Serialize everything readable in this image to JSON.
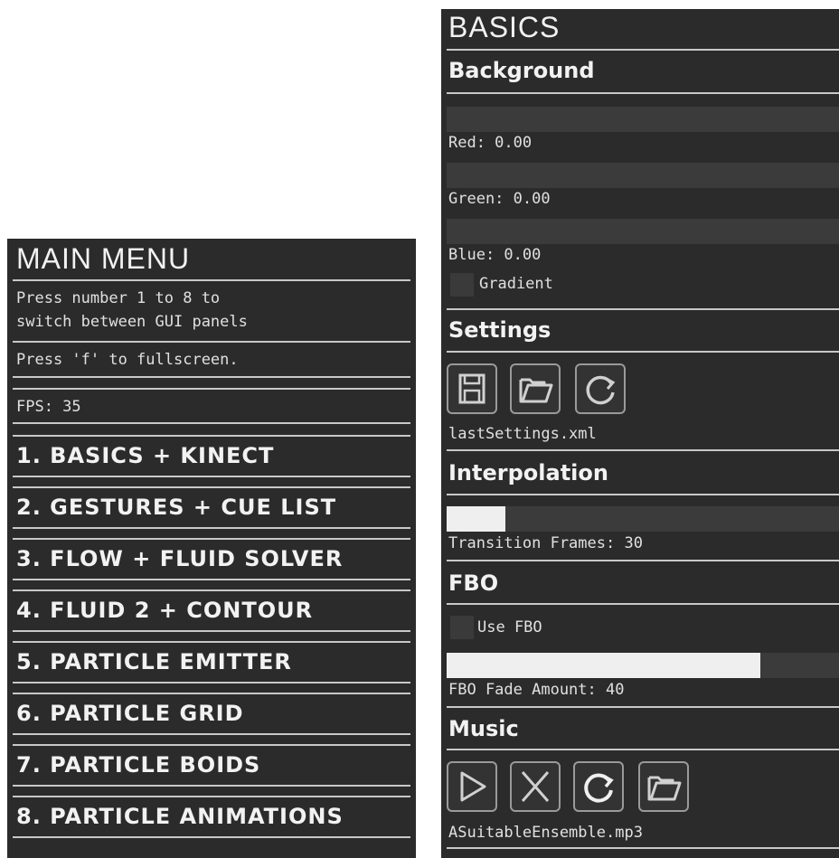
{
  "main_menu": {
    "title": "MAIN MENU",
    "help_line1": "Press number 1 to 8 to",
    "help_line2": "switch between GUI panels",
    "fullscreen_hint": "Press 'f' to fullscreen.",
    "fps": "FPS: 35",
    "items": [
      "1. BASICS + KINECT",
      "2. GESTURES + CUE LIST",
      "3. FLOW + FLUID SOLVER",
      "4. FLUID 2 + CONTOUR",
      "5. PARTICLE EMITTER",
      "6. PARTICLE GRID",
      "7. PARTICLE BOIDS",
      "8. PARTICLE ANIMATIONS"
    ]
  },
  "basics": {
    "title": "BASICS",
    "background": {
      "header": "Background",
      "red": {
        "label": "Red: 0.00",
        "value": 0.0
      },
      "green": {
        "label": "Green: 0.00",
        "value": 0.0
      },
      "blue": {
        "label": "Blue: 0.00",
        "value": 0.0
      },
      "gradient_label": "Gradient"
    },
    "settings": {
      "header": "Settings",
      "icons": [
        "save-icon",
        "folder-open-icon",
        "reload-icon"
      ],
      "filename": "lastSettings.xml"
    },
    "interpolation": {
      "header": "Interpolation",
      "transition_label": "Transition Frames: 30",
      "transition_fraction": 0.15
    },
    "fbo": {
      "header": "FBO",
      "use_label": "Use FBO",
      "fade_label": "FBO Fade Amount: 40",
      "fade_fraction": 0.8
    },
    "music": {
      "header": "Music",
      "icons": [
        "play-icon",
        "stop-icon",
        "reload-icon",
        "folder-open-icon"
      ],
      "filename": "ASuitableEnsemble.mp3"
    }
  },
  "colors": {
    "panel_bg": "#2b2b2b",
    "rule": "#c8c8c8",
    "text": "#e4e4e4",
    "slider_track": "#3b3b3b",
    "slider_fill": "#efefef"
  }
}
